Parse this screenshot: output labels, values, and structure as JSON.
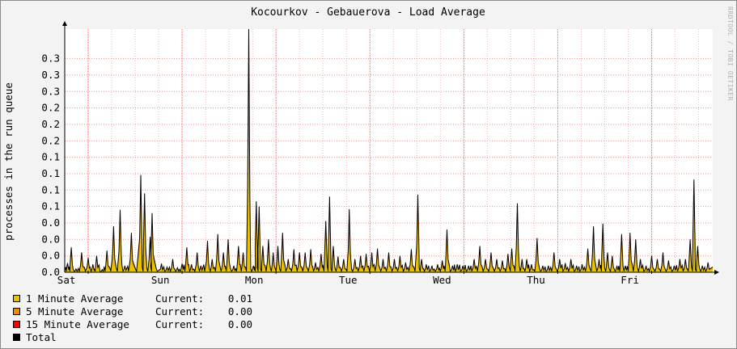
{
  "chart_data": {
    "type": "area",
    "title": "Kocourkov - Gebauerova - Load Average",
    "ylabel": "processes in the run queue",
    "xlabel": "",
    "ylim": [
      0,
      0.37
    ],
    "y_ticks": [
      {
        "value": 0.0,
        "label": "0.0"
      },
      {
        "value": 0.025,
        "label": "0.0"
      },
      {
        "value": 0.05,
        "label": "0.0"
      },
      {
        "value": 0.075,
        "label": "0.0"
      },
      {
        "value": 0.1,
        "label": "0.1"
      },
      {
        "value": 0.125,
        "label": "0.1"
      },
      {
        "value": 0.15,
        "label": "0.1"
      },
      {
        "value": 0.175,
        "label": "0.1"
      },
      {
        "value": 0.2,
        "label": "0.2"
      },
      {
        "value": 0.225,
        "label": "0.2"
      },
      {
        "value": 0.25,
        "label": "0.2"
      },
      {
        "value": 0.275,
        "label": "0.3"
      },
      {
        "value": 0.3,
        "label": "0.3"
      },
      {
        "value": 0.325,
        "label": "0.3"
      }
    ],
    "x_days": [
      "Sat",
      "Sun",
      "Mon",
      "Tue",
      "Wed",
      "Thu",
      "Fri"
    ],
    "x_range_days": [
      -0.25,
      6.65
    ],
    "grid": true,
    "legend_position": "bottom-left",
    "series": [
      {
        "name": "1 Minute Average",
        "color": "#e8c400",
        "current_label": "Current:",
        "current": "0.01"
      },
      {
        "name": "5 Minute Average",
        "color": "#ea8f00",
        "current_label": "Current:",
        "current": "0.00"
      },
      {
        "name": "15 Minute Average",
        "color": "#ff0000",
        "current_label": "Current:",
        "current": "0.00"
      },
      {
        "name": "Total",
        "color": "#000000"
      }
    ],
    "total_peaks": [
      {
        "t": -0.22,
        "v": 0.014
      },
      {
        "t": -0.18,
        "v": 0.038
      },
      {
        "t": -0.13,
        "v": 0.005
      },
      {
        "t": -0.07,
        "v": 0.03
      },
      {
        "t": 0.0,
        "v": 0.022
      },
      {
        "t": 0.05,
        "v": 0.012
      },
      {
        "t": 0.09,
        "v": 0.025
      },
      {
        "t": 0.15,
        "v": 0.004
      },
      {
        "t": 0.2,
        "v": 0.033
      },
      {
        "t": 0.27,
        "v": 0.07
      },
      {
        "t": 0.34,
        "v": 0.095
      },
      {
        "t": 0.39,
        "v": 0.01
      },
      {
        "t": 0.46,
        "v": 0.06
      },
      {
        "t": 0.56,
        "v": 0.148
      },
      {
        "t": 0.6,
        "v": 0.12
      },
      {
        "t": 0.66,
        "v": 0.054
      },
      {
        "t": 0.68,
        "v": 0.09
      },
      {
        "t": 0.78,
        "v": 0.013
      },
      {
        "t": 0.84,
        "v": 0.008
      },
      {
        "t": 0.9,
        "v": 0.02
      },
      {
        "t": 0.95,
        "v": 0.007
      },
      {
        "t": 1.0,
        "v": 0.013
      },
      {
        "t": 1.05,
        "v": 0.038
      },
      {
        "t": 1.1,
        "v": 0.012
      },
      {
        "t": 1.16,
        "v": 0.03
      },
      {
        "t": 1.2,
        "v": 0.01
      },
      {
        "t": 1.27,
        "v": 0.048
      },
      {
        "t": 1.32,
        "v": 0.02
      },
      {
        "t": 1.38,
        "v": 0.058
      },
      {
        "t": 1.44,
        "v": 0.03
      },
      {
        "t": 1.49,
        "v": 0.05
      },
      {
        "t": 1.55,
        "v": 0.01
      },
      {
        "t": 1.6,
        "v": 0.04
      },
      {
        "t": 1.65,
        "v": 0.03
      },
      {
        "t": 1.71,
        "v": 0.372
      },
      {
        "t": 1.76,
        "v": 0.01
      },
      {
        "t": 1.79,
        "v": 0.108
      },
      {
        "t": 1.82,
        "v": 0.1
      },
      {
        "t": 1.86,
        "v": 0.04
      },
      {
        "t": 1.92,
        "v": 0.05
      },
      {
        "t": 1.97,
        "v": 0.03
      },
      {
        "t": 2.02,
        "v": 0.04
      },
      {
        "t": 2.07,
        "v": 0.06
      },
      {
        "t": 2.13,
        "v": 0.02
      },
      {
        "t": 2.19,
        "v": 0.035
      },
      {
        "t": 2.25,
        "v": 0.03
      },
      {
        "t": 2.31,
        "v": 0.03
      },
      {
        "t": 2.37,
        "v": 0.035
      },
      {
        "t": 2.42,
        "v": 0.015
      },
      {
        "t": 2.48,
        "v": 0.028
      },
      {
        "t": 2.53,
        "v": 0.078
      },
      {
        "t": 2.57,
        "v": 0.115
      },
      {
        "t": 2.61,
        "v": 0.04
      },
      {
        "t": 2.66,
        "v": 0.024
      },
      {
        "t": 2.72,
        "v": 0.02
      },
      {
        "t": 2.78,
        "v": 0.096
      },
      {
        "t": 2.84,
        "v": 0.02
      },
      {
        "t": 2.9,
        "v": 0.025
      },
      {
        "t": 2.96,
        "v": 0.028
      },
      {
        "t": 3.02,
        "v": 0.03
      },
      {
        "t": 3.08,
        "v": 0.036
      },
      {
        "t": 3.14,
        "v": 0.02
      },
      {
        "t": 3.2,
        "v": 0.03
      },
      {
        "t": 3.26,
        "v": 0.02
      },
      {
        "t": 3.32,
        "v": 0.025
      },
      {
        "t": 3.38,
        "v": 0.015
      },
      {
        "t": 3.44,
        "v": 0.035
      },
      {
        "t": 3.51,
        "v": 0.118
      },
      {
        "t": 3.55,
        "v": 0.02
      },
      {
        "t": 3.6,
        "v": 0.012
      },
      {
        "t": 3.66,
        "v": 0.01
      },
      {
        "t": 3.72,
        "v": 0.012
      },
      {
        "t": 3.77,
        "v": 0.018
      },
      {
        "t": 3.82,
        "v": 0.065
      },
      {
        "t": 3.88,
        "v": 0.01
      },
      {
        "t": 3.93,
        "v": 0.012
      },
      {
        "t": 3.99,
        "v": 0.01
      },
      {
        "t": 4.05,
        "v": 0.01
      },
      {
        "t": 4.11,
        "v": 0.02
      },
      {
        "t": 4.17,
        "v": 0.04
      },
      {
        "t": 4.23,
        "v": 0.02
      },
      {
        "t": 4.29,
        "v": 0.03
      },
      {
        "t": 4.35,
        "v": 0.02
      },
      {
        "t": 4.41,
        "v": 0.018
      },
      {
        "t": 4.47,
        "v": 0.028
      },
      {
        "t": 4.51,
        "v": 0.036
      },
      {
        "t": 4.57,
        "v": 0.105
      },
      {
        "t": 4.62,
        "v": 0.02
      },
      {
        "t": 4.67,
        "v": 0.02
      },
      {
        "t": 4.72,
        "v": 0.012
      },
      {
        "t": 4.78,
        "v": 0.052
      },
      {
        "t": 4.84,
        "v": 0.01
      },
      {
        "t": 4.9,
        "v": 0.01
      },
      {
        "t": 4.96,
        "v": 0.03
      },
      {
        "t": 5.02,
        "v": 0.02
      },
      {
        "t": 5.08,
        "v": 0.014
      },
      {
        "t": 5.14,
        "v": 0.02
      },
      {
        "t": 5.2,
        "v": 0.01
      },
      {
        "t": 5.26,
        "v": 0.012
      },
      {
        "t": 5.32,
        "v": 0.036
      },
      {
        "t": 5.38,
        "v": 0.07
      },
      {
        "t": 5.44,
        "v": 0.02
      },
      {
        "t": 5.48,
        "v": 0.074
      },
      {
        "t": 5.53,
        "v": 0.03
      },
      {
        "t": 5.58,
        "v": 0.025
      },
      {
        "t": 5.63,
        "v": 0.01
      },
      {
        "t": 5.68,
        "v": 0.058
      },
      {
        "t": 5.72,
        "v": 0.01
      },
      {
        "t": 5.77,
        "v": 0.06
      },
      {
        "t": 5.83,
        "v": 0.05
      },
      {
        "t": 5.88,
        "v": 0.02
      },
      {
        "t": 5.94,
        "v": 0.01
      },
      {
        "t": 6.0,
        "v": 0.025
      },
      {
        "t": 6.06,
        "v": 0.02
      },
      {
        "t": 6.12,
        "v": 0.03
      },
      {
        "t": 6.18,
        "v": 0.018
      },
      {
        "t": 6.24,
        "v": 0.01
      },
      {
        "t": 6.3,
        "v": 0.02
      },
      {
        "t": 6.36,
        "v": 0.02
      },
      {
        "t": 6.41,
        "v": 0.05
      },
      {
        "t": 6.45,
        "v": 0.141
      },
      {
        "t": 6.49,
        "v": 0.04
      },
      {
        "t": 6.54,
        "v": 0.01
      },
      {
        "t": 6.6,
        "v": 0.015
      }
    ]
  },
  "watermark": "RRDTOOL / TOBI OETIKER"
}
